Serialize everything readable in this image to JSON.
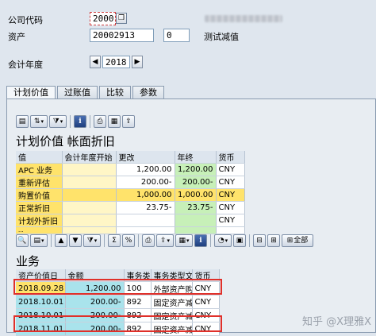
{
  "header": {
    "company_code_label": "公司代码",
    "company_code_value": "2000",
    "asset_label": "资产",
    "asset_number": "20002913",
    "asset_subnumber": "0",
    "asset_description": "测试减值",
    "fiscal_year_label": "会计年度",
    "fiscal_year_value": "2018"
  },
  "tabs": [
    "计划价值",
    "过账值",
    "比较",
    "参数"
  ],
  "planned_section": {
    "title": "计划价值 帐面折旧",
    "columns": [
      "值",
      "会计年度开始",
      "更改",
      "年终",
      "货币"
    ],
    "rows": [
      {
        "label": "APC 业务",
        "start": "",
        "change": "1,200.00",
        "year_end": "1,200.00",
        "currency": "CNY"
      },
      {
        "label": "重新评估",
        "start": "",
        "change": "200.00-",
        "year_end": "200.00-",
        "currency": "CNY"
      },
      {
        "label": "购置价值",
        "start": "",
        "change": "1,000.00",
        "year_end": "1,000.00",
        "currency": "CNY"
      },
      {
        "label": "正常折旧",
        "start": "",
        "change": "23.75-",
        "year_end": "23.75-",
        "currency": "CNY"
      },
      {
        "label": "计划外折旧",
        "start": "",
        "change": "",
        "year_end": "",
        "currency": "CNY"
      },
      {
        "label": "...",
        "start": "",
        "change": "",
        "year_end": "",
        "currency": ""
      }
    ]
  },
  "transactions_section": {
    "title": "业务",
    "select_all_label": "全部",
    "columns": [
      "资产价值日",
      "金额",
      "事务类",
      "事务类型文本",
      "货币"
    ],
    "rows": [
      {
        "date": "2018.09.28",
        "amount": "1,200.00",
        "type": "100",
        "text": "外部资产购置",
        "currency": "CNY"
      },
      {
        "date": "2018.10.01",
        "amount": "200.00-",
        "type": "892",
        "text": "固定资产减值",
        "currency": "CNY"
      },
      {
        "date": "2018.10.01",
        "amount": "200.00-",
        "type": "892",
        "text": "固定资产减值",
        "currency": "CNY"
      },
      {
        "date": "2018.11.01",
        "amount": "200.00-",
        "type": "892",
        "text": "固定资产减值",
        "currency": "CNY"
      }
    ]
  },
  "watermark": "知乎 @X理雅X",
  "colors": {
    "highlight_yellow": "#ffe36b",
    "green_cell": "#c7f0b8",
    "cyan_cell": "#a9e3ec",
    "red_box": "#e0302a"
  }
}
